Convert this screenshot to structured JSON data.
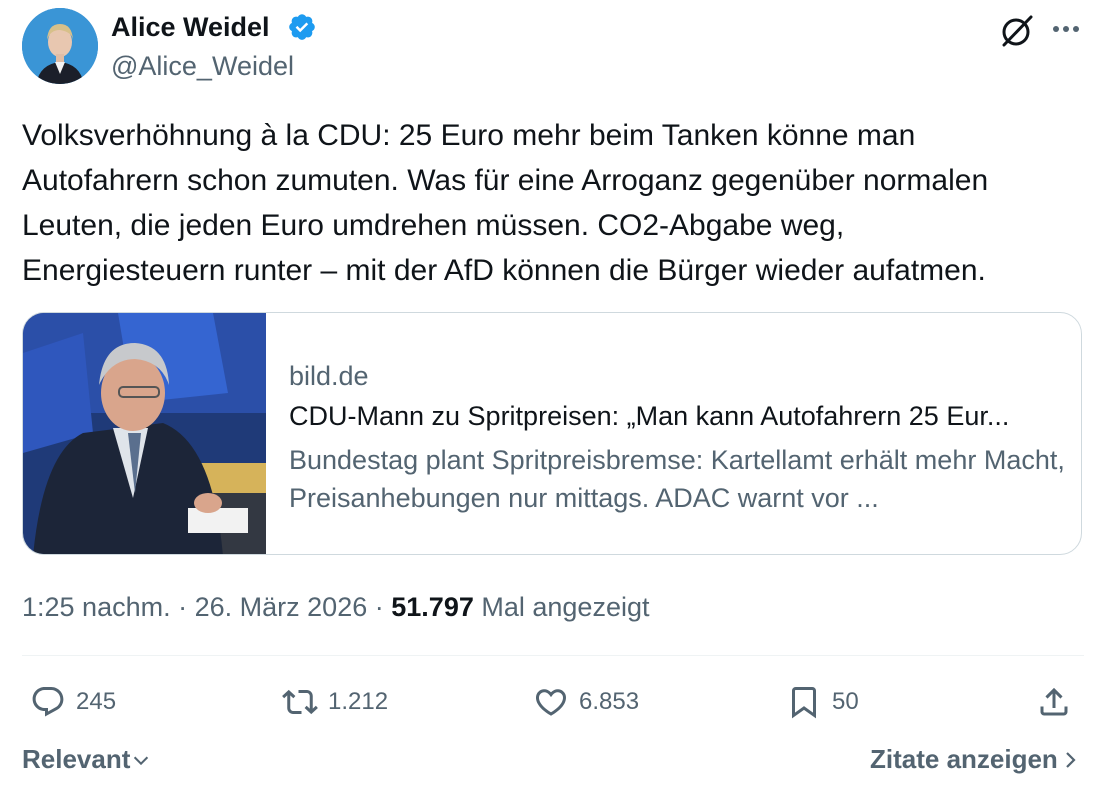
{
  "author": {
    "name": "Alice Weidel",
    "handle": "@Alice_Weidel",
    "verified": true,
    "avatar_icon": "profile-photo",
    "verified_color": "#1d9bf0"
  },
  "tweet": {
    "text": "Volksverhöhnung à la CDU: 25 Euro mehr beim Tanken könne man\nAutofahrern schon zumuten. Was für eine Arroganz gegenüber normalen\nLeuten, die jeden Euro umdrehen müssen. CO2-Abgabe weg,\nEnergiesteuern runter – mit der AfD können die Bürger wieder aufatmen."
  },
  "card": {
    "domain": "bild.de",
    "title": "CDU-Mann zu Spritpreisen: „Man kann Autofahrern 25 Eur...",
    "description": "Bundestag plant Spritpreisbremse: Kartellamt erhält mehr Macht, Preisanhebungen nur mittags. ADAC warnt vor ..."
  },
  "meta": {
    "time": "1:25 nachm.",
    "sep1": "·",
    "date": "26. März 2026",
    "sep2": "·",
    "views_count": "51.797",
    "views_label": "Mal angezeigt"
  },
  "actions": {
    "replies": "245",
    "reposts": "1.212",
    "likes": "6.853",
    "bookmarks": "50"
  },
  "footer": {
    "sort_label": "Relevant",
    "quotes_label": "Zitate anzeigen"
  },
  "icons": [
    "grok-icon",
    "more-icon",
    "reply-icon",
    "repost-icon",
    "like-icon",
    "bookmark-icon",
    "share-icon",
    "chevron-down-icon",
    "chevron-right-icon"
  ]
}
